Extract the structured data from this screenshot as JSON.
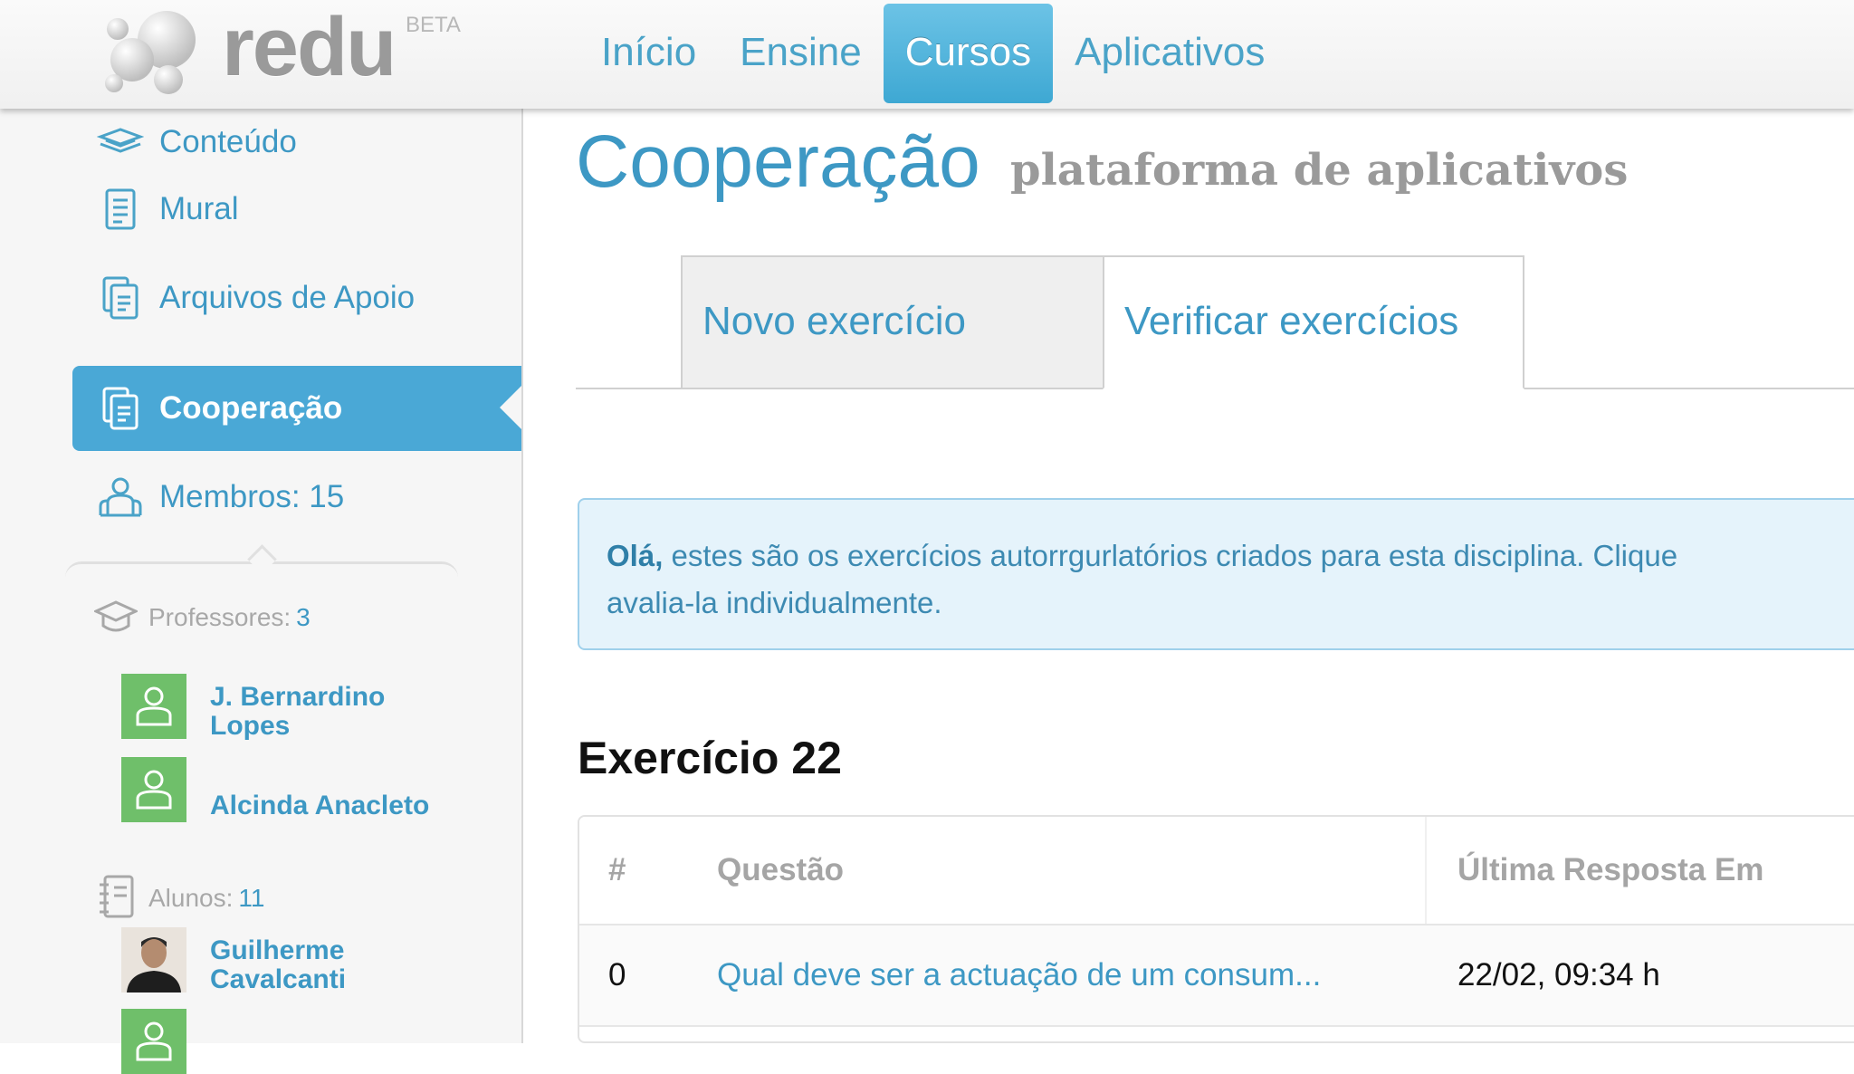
{
  "app": {
    "logo_text": "redu",
    "logo_badge": "BETA"
  },
  "nav": {
    "items": [
      {
        "label": "Início"
      },
      {
        "label": "Ensine"
      },
      {
        "label": "Cursos",
        "active": true
      },
      {
        "label": "Aplicativos"
      }
    ]
  },
  "sidebar": {
    "items": [
      {
        "label": "Conteúdo",
        "icon": "books-icon"
      },
      {
        "label": "Mural",
        "icon": "document-list-icon"
      },
      {
        "label": "Arquivos de Apoio",
        "icon": "files-icon"
      },
      {
        "label": "Cooperação",
        "icon": "files-icon",
        "active": true
      },
      {
        "label": "Membros: 15",
        "icon": "members-icon"
      }
    ],
    "professors": {
      "label": "Professores:",
      "count": "3",
      "people": [
        {
          "name_line1": "J. Bernardino",
          "name_line2": "Lopes"
        },
        {
          "name_line1": "",
          "name_line2": "Alcinda Anacleto"
        }
      ]
    },
    "students": {
      "label": "Alunos:",
      "count": "11",
      "people": [
        {
          "name_line1": "Guilherme",
          "name_line2": "Cavalcanti"
        }
      ]
    }
  },
  "main": {
    "title": "Cooperação",
    "subtitle": "plataforma de aplicativos",
    "tabs": [
      {
        "label": "Novo exercício"
      },
      {
        "label": "Verificar exercícios",
        "active": true
      }
    ],
    "info": {
      "strong": "Olá,",
      "line1": " estes são os exercícios autorrgurlatórios criados para esta disciplina. Clique",
      "line2": "avalia-la individualmente."
    },
    "exercise_title": "Exercício 22",
    "table": {
      "headers": [
        "#",
        "Questão",
        "Última Resposta Em"
      ],
      "rows": [
        {
          "num": "0",
          "question": "Qual deve ser a actuação de um consum...",
          "last_answer": "22/02, 09:34 h"
        }
      ]
    }
  },
  "colors": {
    "accent": "#3d98c4",
    "active_bg": "#4aa8d6",
    "avatar_green": "#6fbf6a",
    "info_bg": "#e5f3fb"
  }
}
